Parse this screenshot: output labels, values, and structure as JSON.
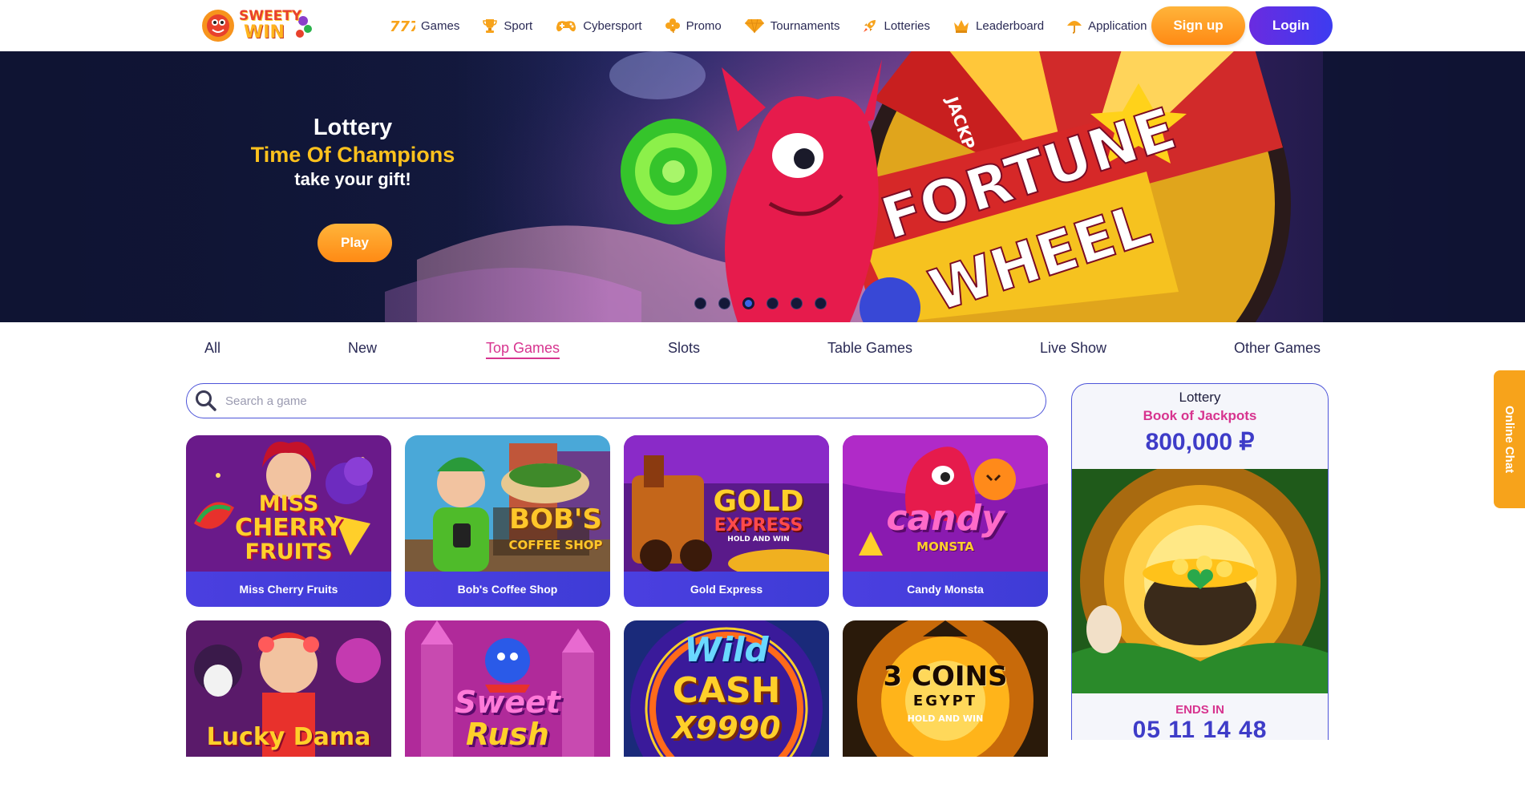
{
  "brand": {
    "logo_line1": "SWEETY",
    "logo_line2": "WIN"
  },
  "nav": [
    {
      "label": "Games",
      "icon": "sevens-icon"
    },
    {
      "label": "Sport",
      "icon": "trophy-icon"
    },
    {
      "label": "Cybersport",
      "icon": "gamepad-icon"
    },
    {
      "label": "Promo",
      "icon": "clover-icon"
    },
    {
      "label": "Tournaments",
      "icon": "diamond-icon"
    },
    {
      "label": "Lotteries",
      "icon": "rocket-icon"
    },
    {
      "label": "Leaderboard",
      "icon": "crown-icon"
    },
    {
      "label": "Application",
      "icon": "umbrella-icon"
    }
  ],
  "auth": {
    "signup_label": "Sign up",
    "login_label": "Login"
  },
  "banner": {
    "line1": "Lottery",
    "line2": "Time Of Champions",
    "line3": "take your gift!",
    "play_label": "Play",
    "art_text_1": "FORTUNE",
    "art_text_2": "WHEEL",
    "art_text_3": "JACKP",
    "slides_count": 6,
    "active_slide": 3
  },
  "tabs": [
    "All",
    "New",
    "Top Games",
    "Slots",
    "Table Games",
    "Live Show",
    "Other Games"
  ],
  "active_tab": "Top Games",
  "search": {
    "placeholder": "Search a game"
  },
  "games": [
    {
      "name": "Miss Cherry Fruits",
      "art_line1": "MISS",
      "art_line2": "CHERRY",
      "art_line3": "FRUITS"
    },
    {
      "name": "Bob's Coffee Shop",
      "art_line1": "BOB'S",
      "art_line2": "COFFEE SHOP",
      "art_line3": ""
    },
    {
      "name": "Gold Express",
      "art_line1": "GOLD",
      "art_line2": "EXPRESS",
      "art_line3": "HOLD AND WIN"
    },
    {
      "name": "Candy Monsta",
      "art_line1": "candy",
      "art_line2": "MONSTA",
      "art_line3": ""
    },
    {
      "name": "",
      "art_line1": "Lucky Dama",
      "art_line2": "",
      "art_line3": ""
    },
    {
      "name": "",
      "art_line1": "Sweet",
      "art_line2": "Rush",
      "art_line3": ""
    },
    {
      "name": "",
      "art_line1": "Wild",
      "art_line2": "CASH",
      "art_line3": "X9990"
    },
    {
      "name": "",
      "art_line1": "3 COINS",
      "art_line2": "EGYPT",
      "art_line3": "HOLD AND WIN"
    }
  ],
  "lottery": {
    "title": "Lottery",
    "name": "Book of Jackpots",
    "amount": "800,000 ₽",
    "ends_label": "ENDS IN",
    "timer": "05 11 14 48"
  },
  "chat": {
    "label": "Online Chat"
  },
  "colors": {
    "accent_orange": "#ff9a1f",
    "accent_purple": "#4b3fe0",
    "accent_pink": "#d7348f",
    "gold": "#ffc21d"
  }
}
